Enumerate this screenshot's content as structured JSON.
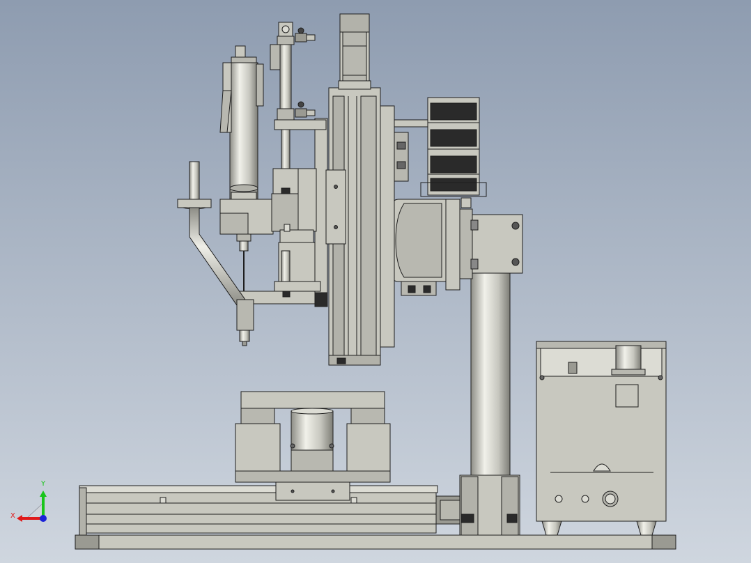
{
  "viewport": {
    "background_top": "#8e9cb0",
    "background_bottom": "#cfd6df"
  },
  "triad": {
    "x_label": "X",
    "y_label": "Y",
    "x_color": "#e01a1a",
    "y_color": "#19c51a",
    "z_color": "#1a22d8"
  },
  "palette": {
    "part": "#c8c8bf",
    "part_light": "#dcdcd4",
    "part_dark": "#9a9a92",
    "edge": "#1e1e1e",
    "shadow": "#6f6f68",
    "black_part": "#2a2a2a"
  }
}
